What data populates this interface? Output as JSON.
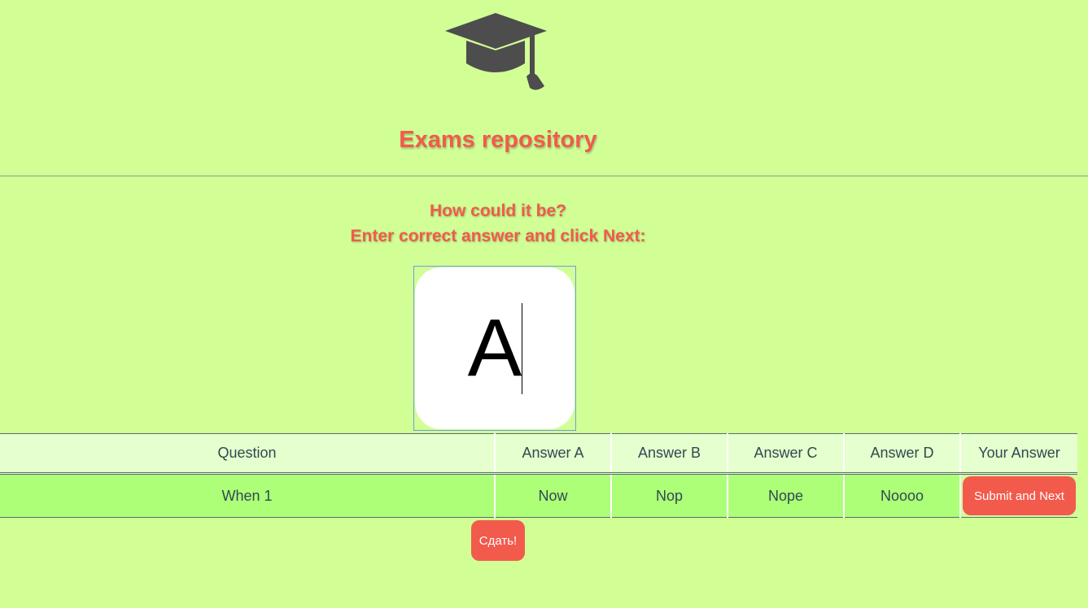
{
  "header": {
    "logo_icon": "graduation-cap-icon",
    "title": "Exams repository"
  },
  "prompt": {
    "question": "How could it be?",
    "instruction": "Enter correct answer and click Next:"
  },
  "answer_input": {
    "value": "A"
  },
  "table": {
    "headers": [
      "Question",
      "Answer A",
      "Answer B",
      "Answer C",
      "Answer D",
      "Your Answer"
    ],
    "rows": [
      {
        "question": "When 1",
        "answer_a": "Now",
        "answer_b": "Nop",
        "answer_c": "Nope",
        "answer_d": "Noooo",
        "action_label": "Submit and Next"
      }
    ]
  },
  "finish_button": {
    "label": "Сдать!"
  },
  "colors": {
    "background": "#d1ff96",
    "accent": "#f25a4c",
    "icon": "#4d4d4d"
  }
}
